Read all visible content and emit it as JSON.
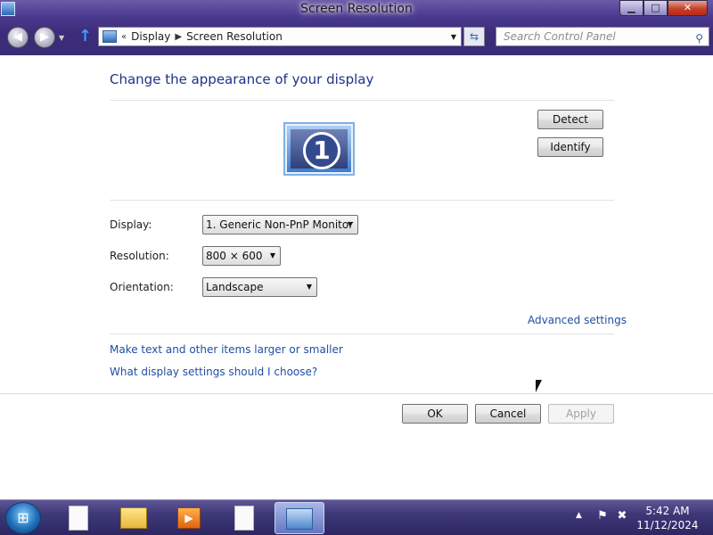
{
  "window": {
    "title": "Screen Resolution",
    "controls": {
      "minimize": "▁",
      "maximize": "□",
      "close": "✕"
    }
  },
  "navigation": {
    "breadcrumb": [
      "Display",
      "Screen Resolution"
    ],
    "search_placeholder": "Search Control Panel"
  },
  "page": {
    "heading": "Change the appearance of your display",
    "monitor_number": "1",
    "detect_label": "Detect",
    "identify_label": "Identify",
    "fields": {
      "display": {
        "label": "Display:",
        "value": "1. Generic Non-PnP Monitor"
      },
      "resolution": {
        "label": "Resolution:",
        "value": "800 × 600"
      },
      "orientation": {
        "label": "Orientation:",
        "value": "Landscape"
      }
    },
    "advanced_link": "Advanced settings",
    "links": [
      "Make text and other items larger or smaller",
      "What display settings should I choose?"
    ],
    "buttons": {
      "ok": "OK",
      "cancel": "Cancel",
      "apply": "Apply"
    }
  },
  "taskbar": {
    "items": [
      "document",
      "file-explorer",
      "media-player",
      "document",
      "control-panel"
    ],
    "active_item": "control-panel",
    "clock": {
      "time": "5:42 AM",
      "date": "11/12/2024"
    }
  }
}
